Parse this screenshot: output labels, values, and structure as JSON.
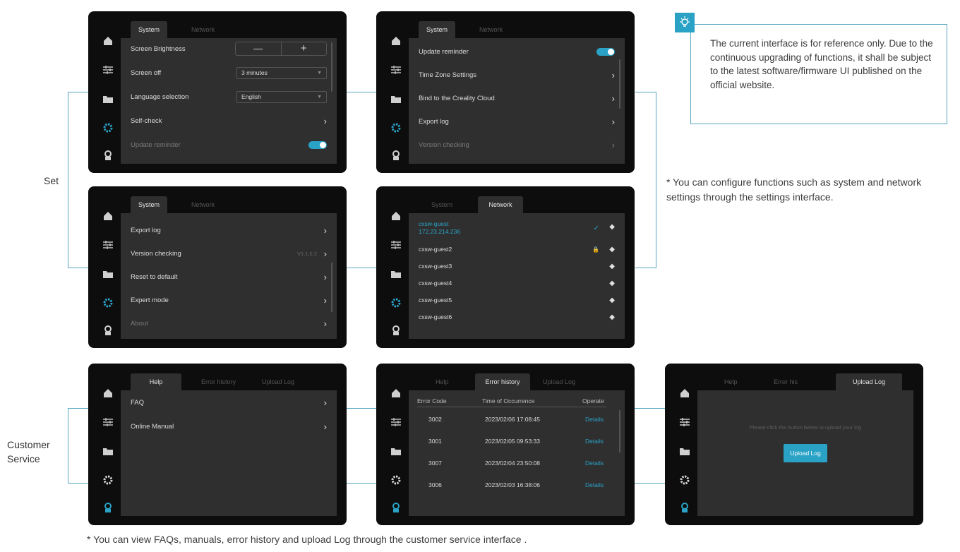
{
  "labels": {
    "set": "Set",
    "customer_service_1": "Customer",
    "customer_service_2": "Service"
  },
  "notes": {
    "reference": "The current interface is for reference only. Due to the continuous upgrading of functions, it shall be subject to the latest software/firmware UI published on the official website.",
    "settings": "* You can configure functions such as system and network settings through the settings interface.",
    "customer_service": "* You can view FAQs, manuals, error history and upload Log through the customer service interface ."
  },
  "colors": {
    "accent": "#2aa2c6",
    "connector": "#57a6c2",
    "screen_bg": "#0d0d0d",
    "panel_bg": "#2f2f2f"
  },
  "sidebar_icons": [
    "home-icon",
    "adjust-icon",
    "folder-icon",
    "settings-gear-icon",
    "customer-service-icon"
  ],
  "screen1": {
    "tabs": [
      "System",
      "Network"
    ],
    "rows": [
      {
        "label": "Screen Brightness",
        "minus": "—",
        "plus": "+"
      },
      {
        "label": "Screen off",
        "value": "3 minutes"
      },
      {
        "label": "Language selection",
        "value": "English"
      },
      {
        "label": "Self-check"
      },
      {
        "label": "Update reminder"
      }
    ]
  },
  "screen2": {
    "tabs": [
      "System",
      "Network"
    ],
    "rows": [
      "Update reminder",
      "Time Zone Settings",
      "Bind to the Creality Cloud",
      "Export log",
      "Version checking"
    ]
  },
  "screen3": {
    "tabs": [
      "System",
      "Network"
    ],
    "rows": [
      "Export log",
      "Version checking",
      "Reset to default",
      "Expert mode",
      "About"
    ],
    "version": "V1.1.0.2"
  },
  "screen4": {
    "tabs": [
      "System",
      "Network"
    ],
    "connected": {
      "ssid": "cxsw-guest",
      "ip": "172.23.214.236"
    },
    "networks": [
      "cxsw-guest2",
      "cxsw-guest3",
      "cxsw-guest4",
      "cxsw-guest5",
      "cxsw-guest6"
    ]
  },
  "screen5": {
    "tabs": [
      "Help",
      "Error history",
      "Upload Log"
    ],
    "rows": [
      "FAQ",
      "Online Manual"
    ]
  },
  "screen6": {
    "tabs": [
      "Help",
      "Error history",
      "Upload Log"
    ],
    "headers": [
      "Error Code",
      "Time of Occurrence",
      "Operate"
    ],
    "rows": [
      {
        "code": "3002",
        "time": "2023/02/06 17:08:45",
        "op": "Details"
      },
      {
        "code": "3001",
        "time": "2023/02/05 09:53:33",
        "op": "Details"
      },
      {
        "code": "3007",
        "time": "2023/02/04 23:50:08",
        "op": "Details"
      },
      {
        "code": "3006",
        "time": "2023/02/03 16:38:06",
        "op": "Details"
      }
    ]
  },
  "screen7": {
    "tabs": [
      "Help",
      "Error his",
      "Upload Log"
    ],
    "message": "Please click the button below to upload your log",
    "button": "Upload Log"
  }
}
